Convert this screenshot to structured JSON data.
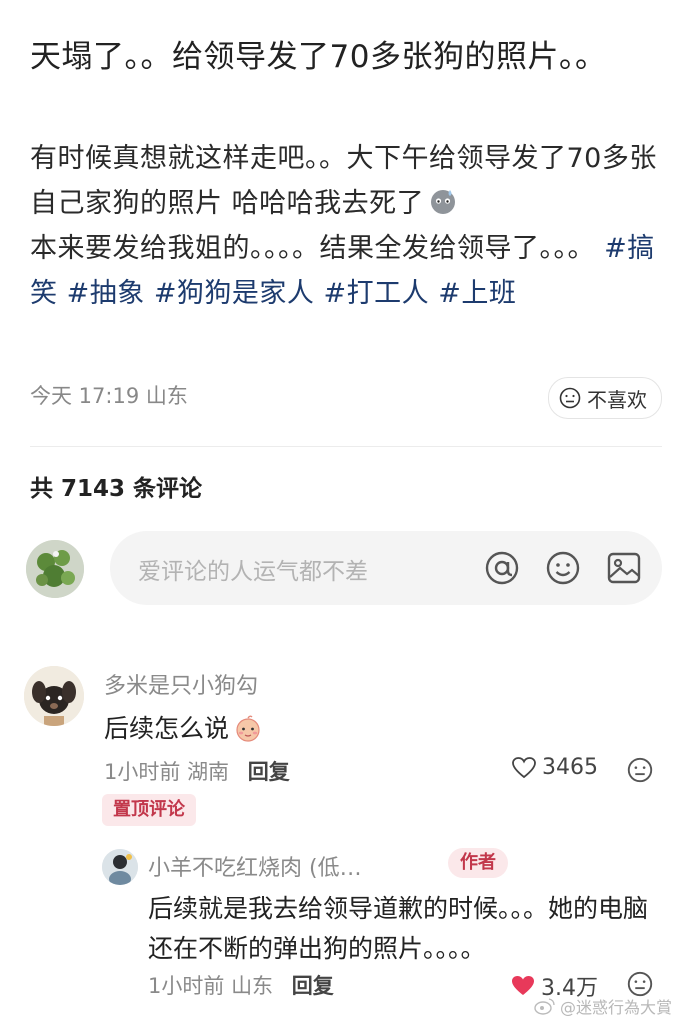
{
  "post": {
    "title": "天塌了。。给领导发了70多张狗的照片。。",
    "body_lines": [
      "有时候真想就这样走吧。。大下午给领导发了70多张自己家狗的照片 哈哈哈我去死了",
      "本来要发给我姐的。。。。结果全发给领导了。。。"
    ],
    "tags": [
      "#搞笑",
      "#抽象",
      "#狗狗是家人",
      "#打工人",
      "#上班"
    ],
    "time": "今天 17:19",
    "location": "山东",
    "dislike_label": "不喜欢"
  },
  "comments_header": {
    "count_text": "共 7143 条评论"
  },
  "comment_input": {
    "placeholder": "爱评论的人运气都不差"
  },
  "comments": [
    {
      "username": "多米是只小狗勾",
      "text": "后续怎么说",
      "time": "1小时前",
      "location": "湖南",
      "reply_label": "回复",
      "likes": "3465",
      "pinned_label": "置顶评论",
      "replies": [
        {
          "username": "小羊不吃红烧肉 (低…",
          "badge": "作者",
          "text": "后续就是我去给领导道歉的时候。。。她的电脑还在不断的弹出狗的照片。。。。",
          "time": "1小时前",
          "location": "山东",
          "reply_label": "回复",
          "likes": "3.4万"
        }
      ]
    }
  ],
  "watermark": "@迷惑行為大賞",
  "colors": {
    "tag": "#1d3b6e",
    "pinned_bg": "#fbe8ea",
    "pinned_text": "#c2374b",
    "liked_heart": "#e8395a"
  }
}
